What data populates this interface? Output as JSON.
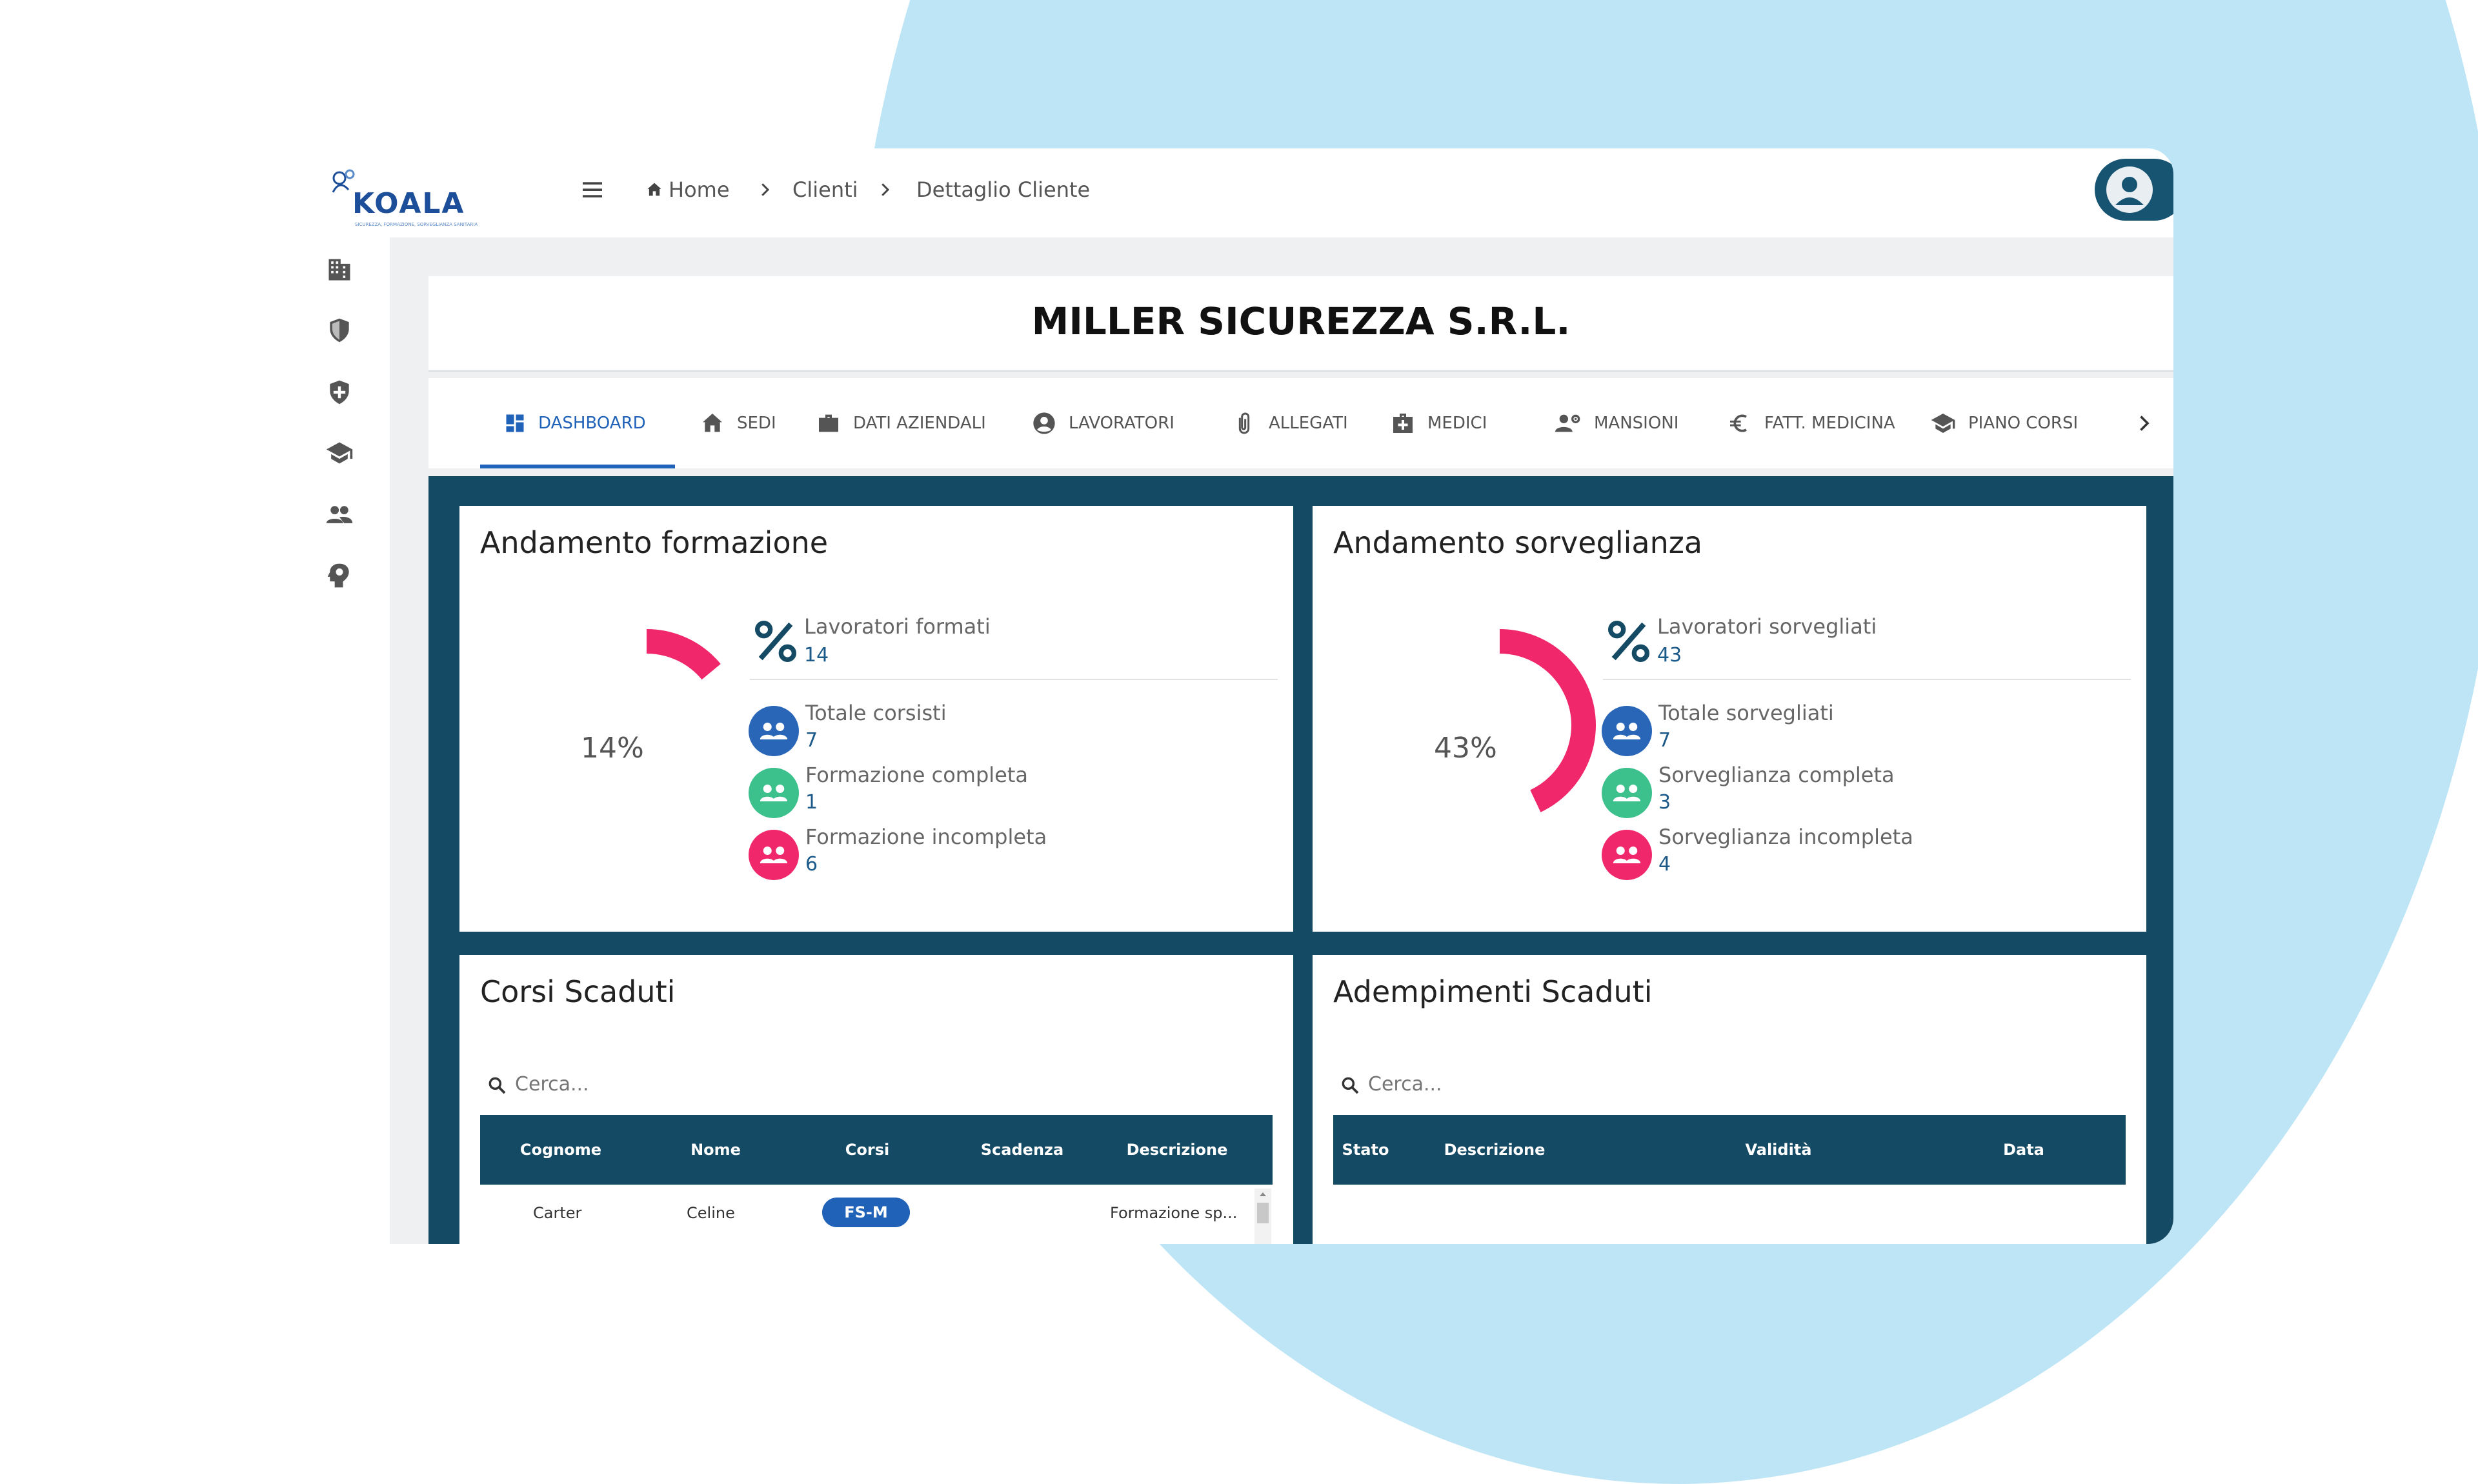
{
  "app": {
    "logo_text": "KOALA",
    "logo_subtitle": "SICUREZZA, FORMAZIONE, SORVEGLIANZA SANITARIA",
    "colors": {
      "primary": "#154a64",
      "accent": "#1f62b8",
      "pink": "#f0286b",
      "green": "#3cc08c",
      "blue": "#2a66b8",
      "bg_circle": "#bde5f5"
    }
  },
  "header": {
    "menu_icon": "hamburger-icon",
    "breadcrumb": [
      {
        "label": "Home",
        "icon": "home-icon"
      },
      {
        "label": "Clienti"
      },
      {
        "label": "Dettaglio Cliente"
      }
    ],
    "user_icon": "account-circle-icon"
  },
  "sidebar": {
    "items": [
      {
        "icon": "building-icon"
      },
      {
        "icon": "shield-icon"
      },
      {
        "icon": "shield-plus-icon"
      },
      {
        "icon": "graduation-cap-icon"
      },
      {
        "icon": "people-icon"
      },
      {
        "icon": "head-idea-icon"
      }
    ]
  },
  "client": {
    "name": "MILLER SICUREZZA S.R.L."
  },
  "tabs": [
    {
      "label": "DASHBOARD",
      "icon": "dashboard-icon",
      "active": true
    },
    {
      "label": "SEDI",
      "icon": "home-icon"
    },
    {
      "label": "DATI AZIENDALI",
      "icon": "briefcase-icon"
    },
    {
      "label": "LAVORATORI",
      "icon": "account-circle-icon"
    },
    {
      "label": "ALLEGATI",
      "icon": "paperclip-icon"
    },
    {
      "label": "MEDICI",
      "icon": "medical-bag-icon"
    },
    {
      "label": "MANSIONI",
      "icon": "person-settings-icon"
    },
    {
      "label": "FATT. MEDICINA",
      "icon": "euro-icon"
    },
    {
      "label": "PIANO CORSI",
      "icon": "graduation-cap-icon"
    }
  ],
  "formazione": {
    "title": "Andamento formazione",
    "percent_label": "14%",
    "percent": 14,
    "headline_label": "Lavoratori formati",
    "headline_value": "14",
    "stats": [
      {
        "label": "Totale corsisti",
        "value": "7",
        "color": "#2a66b8"
      },
      {
        "label": "Formazione completa",
        "value": "1",
        "color": "#3cc08c"
      },
      {
        "label": "Formazione incompleta",
        "value": "6",
        "color": "#f0286b"
      }
    ]
  },
  "sorveglianza": {
    "title": "Andamento sorveglianza",
    "percent_label": "43%",
    "percent": 43,
    "headline_label": "Lavoratori sorvegliati",
    "headline_value": "43",
    "stats": [
      {
        "label": "Totale sorvegliati",
        "value": "7",
        "color": "#2a66b8"
      },
      {
        "label": "Sorveglianza completa",
        "value": "3",
        "color": "#3cc08c"
      },
      {
        "label": "Sorveglianza incompleta",
        "value": "4",
        "color": "#f0286b"
      }
    ]
  },
  "corsi_scaduti": {
    "title": "Corsi Scaduti",
    "search_placeholder": "Cerca...",
    "columns": [
      "Cognome",
      "Nome",
      "Corsi",
      "Scadenza",
      "Descrizione"
    ],
    "rows": [
      {
        "cognome": "Carter",
        "nome": "Celine",
        "corso": "FS-M",
        "scadenza": "",
        "descrizione": "Formazione sp..."
      }
    ]
  },
  "adempimenti_scaduti": {
    "title": "Adempimenti Scaduti",
    "search_placeholder": "Cerca...",
    "columns": [
      "Stato",
      "Descrizione",
      "Validità",
      "Data"
    ]
  }
}
